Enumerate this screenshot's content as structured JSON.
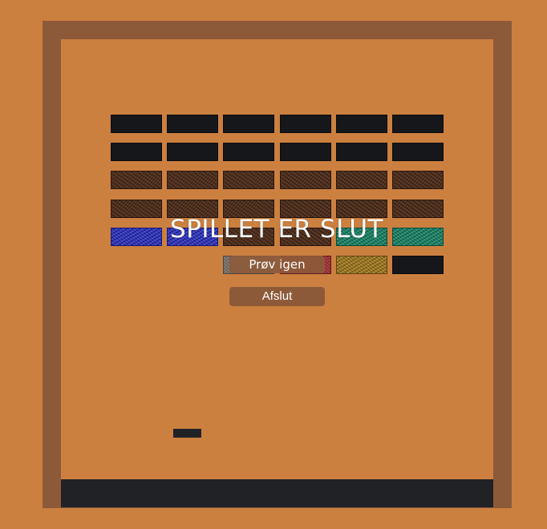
{
  "game": {
    "status_title": "SPILLET ER SLUT",
    "retry_label": "Prøv igen",
    "quit_label": "Afslut"
  },
  "colors": {
    "background": "#CC8040",
    "frame": "#8D5A39",
    "bottom_bar": "#202226",
    "paddle": "#202226",
    "button": "#8D5A39",
    "brick_black": "#15171a",
    "brick_brown": "#4a2b1b",
    "brick_blue": "#2a2fc4",
    "brick_green": "#17836a",
    "brick_gold": "#a07a22",
    "brick_gray": "#7d7770",
    "brick_red": "#a8343a"
  },
  "bricks": [
    [
      "black",
      "black",
      "black",
      "black",
      "black",
      "black"
    ],
    [
      "black",
      "black",
      "black",
      "black",
      "black",
      "black"
    ],
    [
      "brown",
      "brown",
      "brown",
      "brown",
      "brown",
      "brown"
    ],
    [
      "brown",
      "brown",
      "brown",
      "brown",
      "brown",
      "brown"
    ],
    [
      "blue",
      "blue",
      "brown",
      "brown",
      "green",
      "green"
    ],
    [
      null,
      null,
      "gray",
      "red",
      "gold",
      "black"
    ]
  ]
}
